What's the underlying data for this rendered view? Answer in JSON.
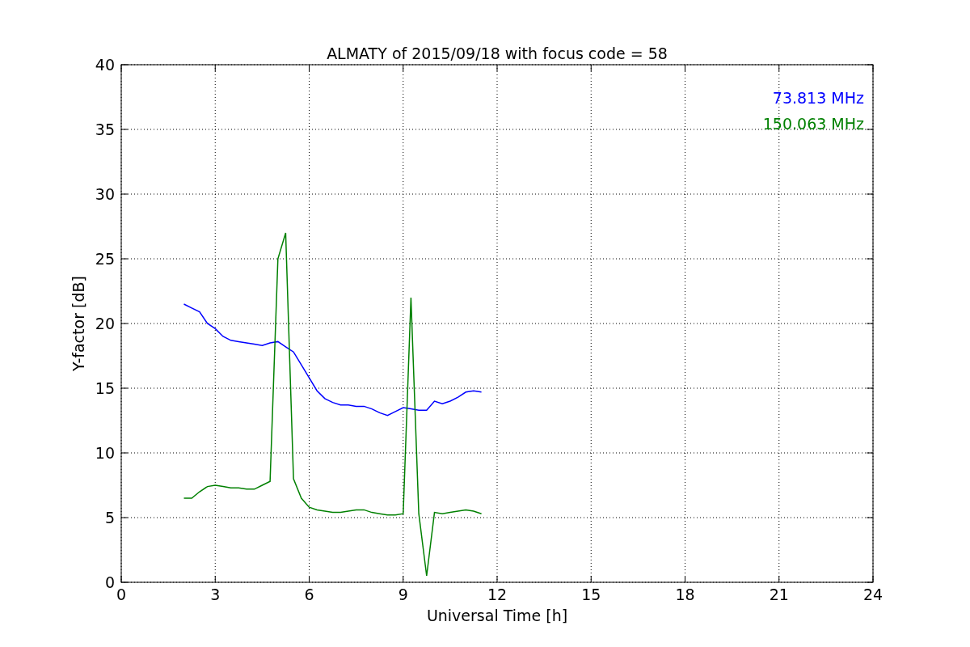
{
  "figure": {
    "chart_data": {
      "type": "line",
      "title": "ALMATY of 2015/09/18 with focus code = 58",
      "xlabel": "Universal Time [h]",
      "ylabel": "Y-factor [dB]",
      "x": [
        2,
        2.25,
        2.5,
        2.75,
        3,
        3.25,
        3.5,
        3.75,
        4,
        4.25,
        4.5,
        4.75,
        5,
        5.25,
        5.5,
        5.75,
        6,
        6.25,
        6.5,
        6.75,
        7,
        7.25,
        7.5,
        7.75,
        8,
        8.25,
        8.5,
        8.75,
        9,
        9.25,
        9.5,
        9.75,
        10,
        10.25,
        10.5,
        10.75,
        11,
        11.25,
        11.5
      ],
      "series": [
        {
          "name": "73.813 MHz",
          "color": "#0000ff",
          "values": [
            21.5,
            21.2,
            20.9,
            20.0,
            19.6,
            19.0,
            18.7,
            18.6,
            18.5,
            18.4,
            18.3,
            18.5,
            18.6,
            18.2,
            17.8,
            16.8,
            15.8,
            14.8,
            14.2,
            13.9,
            13.7,
            13.7,
            13.6,
            13.6,
            13.4,
            13.1,
            12.9,
            13.2,
            13.5,
            13.4,
            13.3,
            13.3,
            14.0,
            13.8,
            14.0,
            14.3,
            14.7,
            14.8,
            14.7
          ]
        },
        {
          "name": "150.063 MHz",
          "color": "#008000",
          "values": [
            6.5,
            6.5,
            7.0,
            7.4,
            7.5,
            7.4,
            7.3,
            7.3,
            7.2,
            7.2,
            7.5,
            7.8,
            25.0,
            27.0,
            8.0,
            6.5,
            5.8,
            5.6,
            5.5,
            5.4,
            5.4,
            5.5,
            5.6,
            5.6,
            5.4,
            5.3,
            5.2,
            5.2,
            5.3,
            22.0,
            5.3,
            0.5,
            5.4,
            5.3,
            5.4,
            5.5,
            5.6,
            5.5,
            5.3
          ]
        }
      ],
      "grid": true,
      "xlim": [
        0,
        24
      ],
      "ylim": [
        0,
        40
      ],
      "xticks": [
        0,
        3,
        6,
        9,
        12,
        15,
        18,
        21,
        24
      ],
      "yticks": [
        0,
        5,
        10,
        15,
        20,
        25,
        30,
        35,
        40
      ]
    }
  }
}
